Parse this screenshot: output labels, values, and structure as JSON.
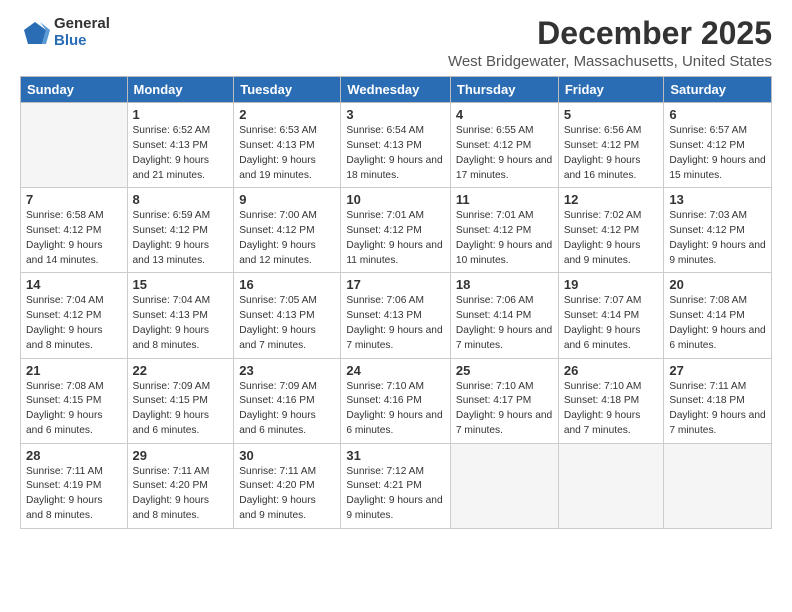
{
  "logo": {
    "general": "General",
    "blue": "Blue"
  },
  "title": "December 2025",
  "location": "West Bridgewater, Massachusetts, United States",
  "weekdays": [
    "Sunday",
    "Monday",
    "Tuesday",
    "Wednesday",
    "Thursday",
    "Friday",
    "Saturday"
  ],
  "weeks": [
    [
      {
        "day": "",
        "empty": true
      },
      {
        "day": "1",
        "sunrise": "6:52 AM",
        "sunset": "4:13 PM",
        "daylight": "9 hours and 21 minutes."
      },
      {
        "day": "2",
        "sunrise": "6:53 AM",
        "sunset": "4:13 PM",
        "daylight": "9 hours and 19 minutes."
      },
      {
        "day": "3",
        "sunrise": "6:54 AM",
        "sunset": "4:13 PM",
        "daylight": "9 hours and 18 minutes."
      },
      {
        "day": "4",
        "sunrise": "6:55 AM",
        "sunset": "4:12 PM",
        "daylight": "9 hours and 17 minutes."
      },
      {
        "day": "5",
        "sunrise": "6:56 AM",
        "sunset": "4:12 PM",
        "daylight": "9 hours and 16 minutes."
      },
      {
        "day": "6",
        "sunrise": "6:57 AM",
        "sunset": "4:12 PM",
        "daylight": "9 hours and 15 minutes."
      }
    ],
    [
      {
        "day": "7",
        "sunrise": "6:58 AM",
        "sunset": "4:12 PM",
        "daylight": "9 hours and 14 minutes."
      },
      {
        "day": "8",
        "sunrise": "6:59 AM",
        "sunset": "4:12 PM",
        "daylight": "9 hours and 13 minutes."
      },
      {
        "day": "9",
        "sunrise": "7:00 AM",
        "sunset": "4:12 PM",
        "daylight": "9 hours and 12 minutes."
      },
      {
        "day": "10",
        "sunrise": "7:01 AM",
        "sunset": "4:12 PM",
        "daylight": "9 hours and 11 minutes."
      },
      {
        "day": "11",
        "sunrise": "7:01 AM",
        "sunset": "4:12 PM",
        "daylight": "9 hours and 10 minutes."
      },
      {
        "day": "12",
        "sunrise": "7:02 AM",
        "sunset": "4:12 PM",
        "daylight": "9 hours and 9 minutes."
      },
      {
        "day": "13",
        "sunrise": "7:03 AM",
        "sunset": "4:12 PM",
        "daylight": "9 hours and 9 minutes."
      }
    ],
    [
      {
        "day": "14",
        "sunrise": "7:04 AM",
        "sunset": "4:12 PM",
        "daylight": "9 hours and 8 minutes."
      },
      {
        "day": "15",
        "sunrise": "7:04 AM",
        "sunset": "4:13 PM",
        "daylight": "9 hours and 8 minutes."
      },
      {
        "day": "16",
        "sunrise": "7:05 AM",
        "sunset": "4:13 PM",
        "daylight": "9 hours and 7 minutes."
      },
      {
        "day": "17",
        "sunrise": "7:06 AM",
        "sunset": "4:13 PM",
        "daylight": "9 hours and 7 minutes."
      },
      {
        "day": "18",
        "sunrise": "7:06 AM",
        "sunset": "4:14 PM",
        "daylight": "9 hours and 7 minutes."
      },
      {
        "day": "19",
        "sunrise": "7:07 AM",
        "sunset": "4:14 PM",
        "daylight": "9 hours and 6 minutes."
      },
      {
        "day": "20",
        "sunrise": "7:08 AM",
        "sunset": "4:14 PM",
        "daylight": "9 hours and 6 minutes."
      }
    ],
    [
      {
        "day": "21",
        "sunrise": "7:08 AM",
        "sunset": "4:15 PM",
        "daylight": "9 hours and 6 minutes."
      },
      {
        "day": "22",
        "sunrise": "7:09 AM",
        "sunset": "4:15 PM",
        "daylight": "9 hours and 6 minutes."
      },
      {
        "day": "23",
        "sunrise": "7:09 AM",
        "sunset": "4:16 PM",
        "daylight": "9 hours and 6 minutes."
      },
      {
        "day": "24",
        "sunrise": "7:10 AM",
        "sunset": "4:16 PM",
        "daylight": "9 hours and 6 minutes."
      },
      {
        "day": "25",
        "sunrise": "7:10 AM",
        "sunset": "4:17 PM",
        "daylight": "9 hours and 7 minutes."
      },
      {
        "day": "26",
        "sunrise": "7:10 AM",
        "sunset": "4:18 PM",
        "daylight": "9 hours and 7 minutes."
      },
      {
        "day": "27",
        "sunrise": "7:11 AM",
        "sunset": "4:18 PM",
        "daylight": "9 hours and 7 minutes."
      }
    ],
    [
      {
        "day": "28",
        "sunrise": "7:11 AM",
        "sunset": "4:19 PM",
        "daylight": "9 hours and 8 minutes."
      },
      {
        "day": "29",
        "sunrise": "7:11 AM",
        "sunset": "4:20 PM",
        "daylight": "9 hours and 8 minutes."
      },
      {
        "day": "30",
        "sunrise": "7:11 AM",
        "sunset": "4:20 PM",
        "daylight": "9 hours and 9 minutes."
      },
      {
        "day": "31",
        "sunrise": "7:12 AM",
        "sunset": "4:21 PM",
        "daylight": "9 hours and 9 minutes."
      },
      {
        "day": "",
        "empty": true
      },
      {
        "day": "",
        "empty": true
      },
      {
        "day": "",
        "empty": true
      }
    ]
  ]
}
